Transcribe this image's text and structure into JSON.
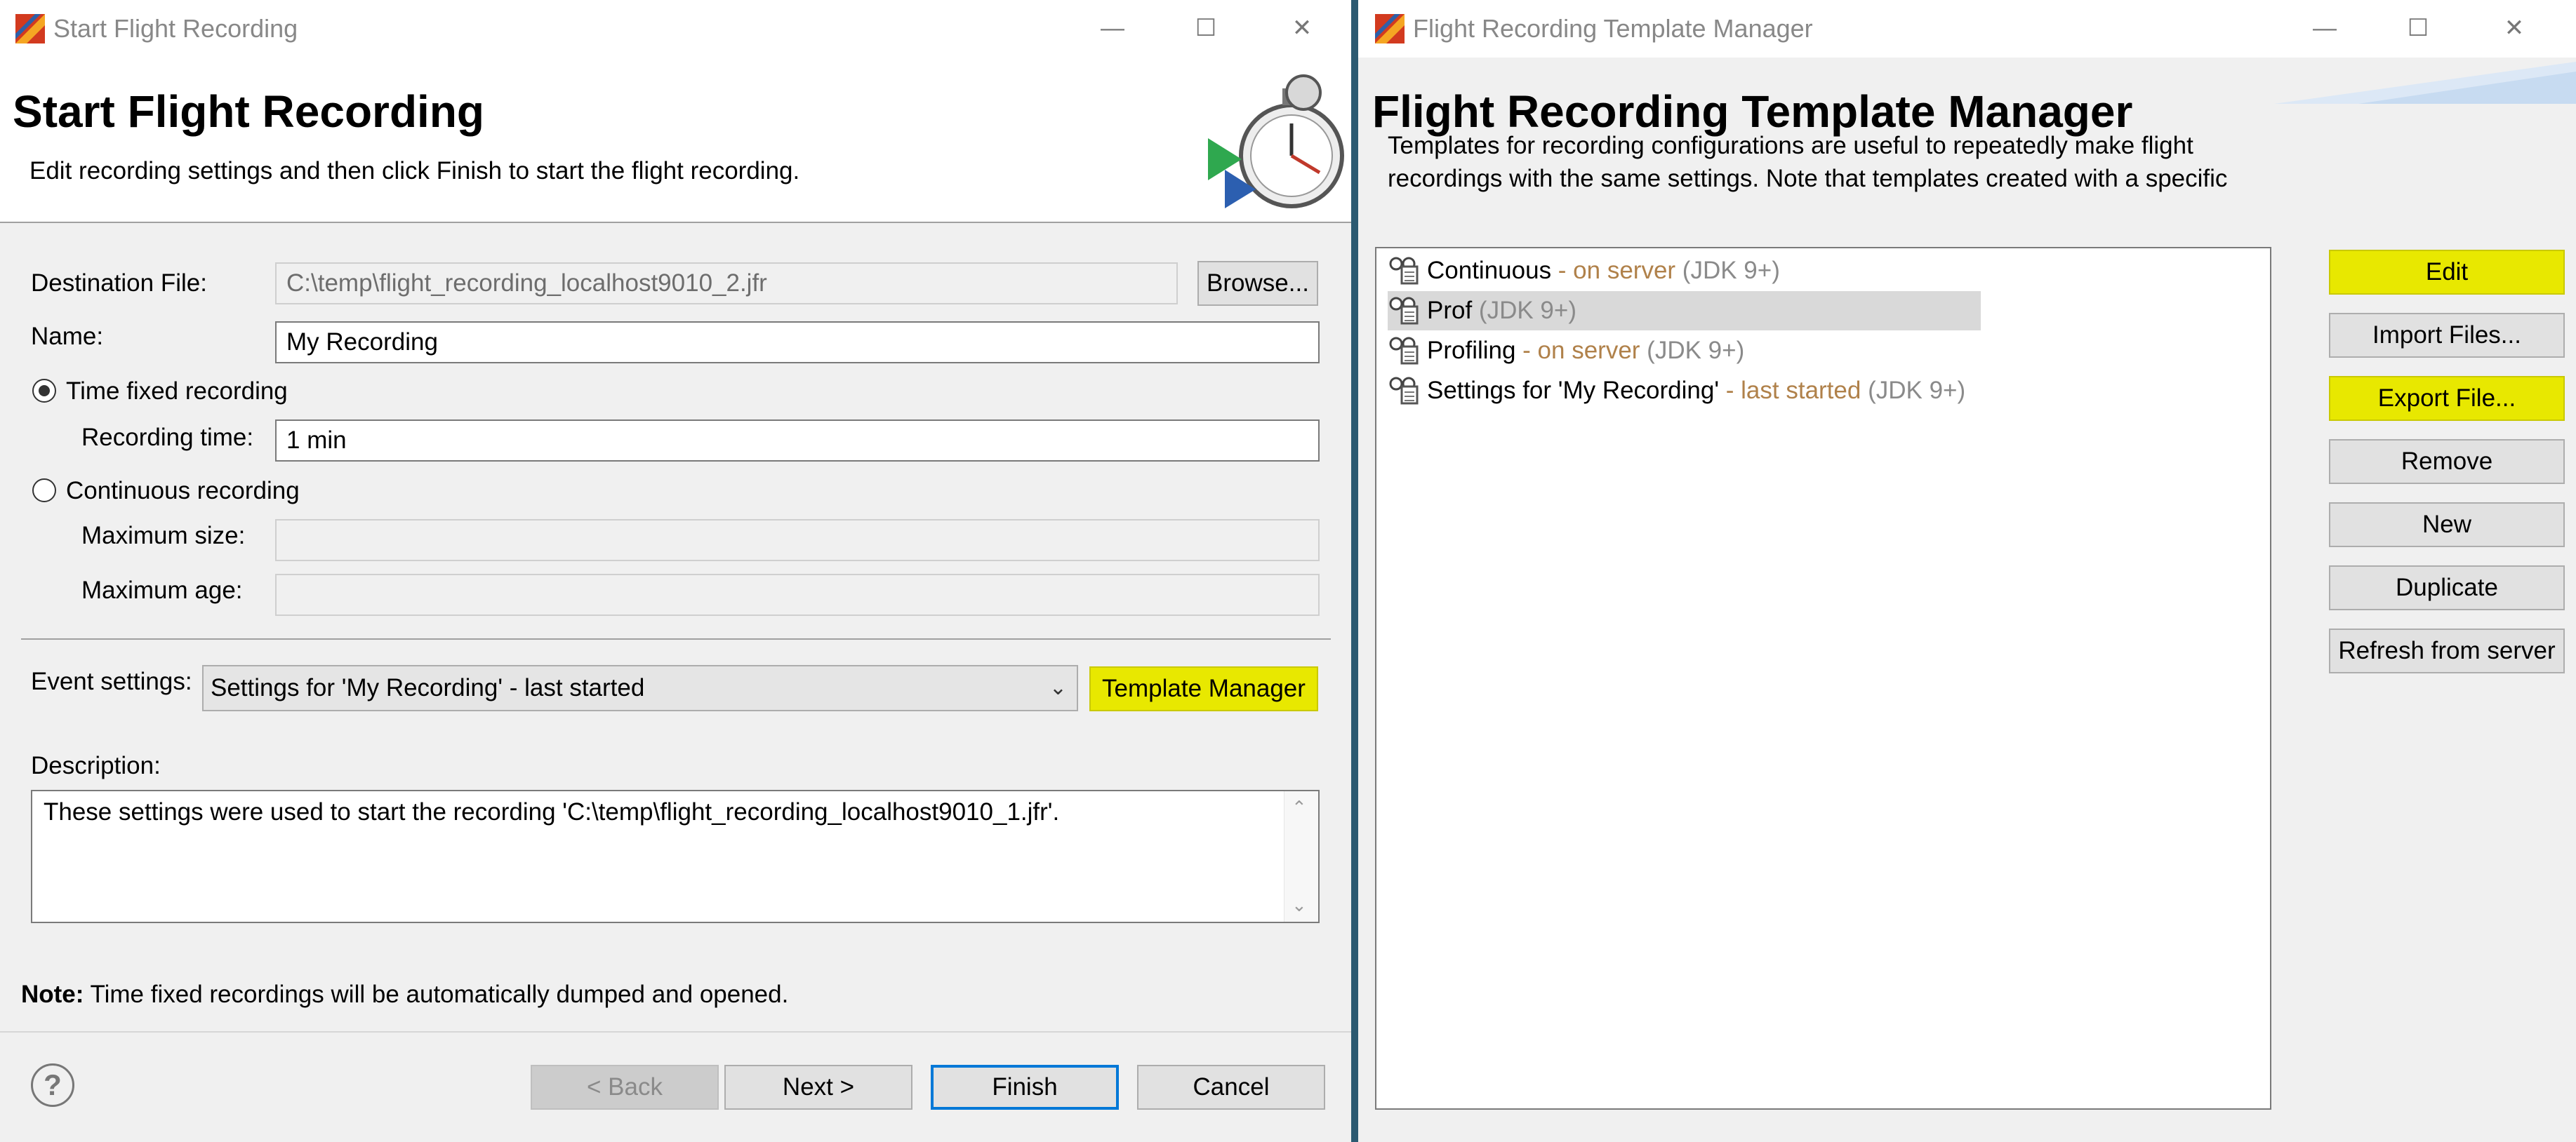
{
  "left": {
    "window_title": "Start Flight Recording",
    "title": "Start Flight Recording",
    "subtitle": "Edit recording settings and then click Finish to start the flight recording.",
    "destination": {
      "label": "Destination File:",
      "value": "C:\\temp\\flight_recording_localhost9010_2.jfr",
      "browse": "Browse..."
    },
    "name": {
      "label": "Name:",
      "value": "My Recording"
    },
    "time_fixed": {
      "label": "Time fixed recording",
      "selected": true
    },
    "recording_time": {
      "label": "Recording time:",
      "value": "1 min"
    },
    "continuous": {
      "label": "Continuous recording",
      "selected": false
    },
    "max_size": {
      "label": "Maximum size:",
      "value": ""
    },
    "max_age": {
      "label": "Maximum age:",
      "value": ""
    },
    "event_settings": {
      "label": "Event settings:",
      "value": "Settings for 'My Recording' - last started",
      "template_manager": "Template Manager"
    },
    "description": {
      "label": "Description:",
      "value": "These settings were used to start the recording 'C:\\temp\\flight_recording_localhost9010_1.jfr'."
    },
    "note": {
      "bold": "Note:",
      "text": "Time fixed recordings will be automatically dumped and opened."
    },
    "help": "?",
    "buttons": {
      "back": "< Back",
      "next": "Next >",
      "finish": "Finish",
      "cancel": "Cancel"
    }
  },
  "right": {
    "window_title": "Flight Recording Template Manager",
    "title": "Flight Recording Template Manager",
    "subtitle": "Templates for recording configurations are useful to repeatedly make flight recordings with the same settings. Note that templates created with a specific",
    "templates": [
      {
        "name": "Continuous",
        "status": " - on server",
        "jdk": " (JDK 9+)",
        "selected": false
      },
      {
        "name": "Prof",
        "status": "",
        "jdk": " (JDK 9+)",
        "selected": true
      },
      {
        "name": "Profiling",
        "status": " - on server",
        "jdk": " (JDK 9+)",
        "selected": false
      },
      {
        "name": "Settings for 'My Recording'",
        "status": " - last started",
        "jdk": " (JDK 9+)",
        "selected": false
      }
    ],
    "buttons": {
      "edit": "Edit",
      "import": "Import Files...",
      "export": "Export File...",
      "remove": "Remove",
      "new": "New",
      "duplicate": "Duplicate",
      "refresh": "Refresh from server"
    }
  },
  "window_controls": {
    "minimize": "—",
    "maximize": "☐",
    "close": "✕"
  },
  "colors": {
    "highlight": "#e8e800",
    "divider": "#2c5a71",
    "status_text": "#b0814a",
    "jdk_text": "#8a8a8a",
    "focus_border": "#0078d7"
  }
}
